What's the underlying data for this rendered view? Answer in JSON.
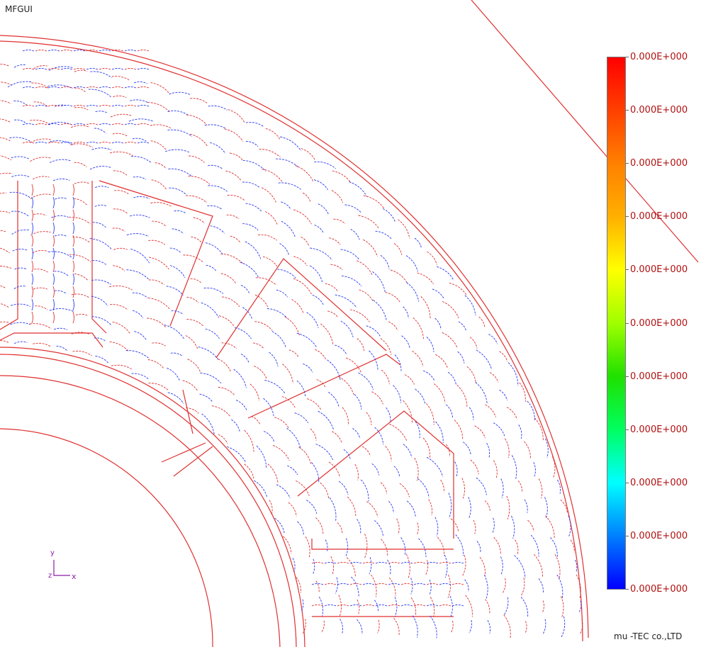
{
  "app": {
    "title": "MFGUI",
    "footer": "mu -TEC co.,LTD"
  },
  "colorbar": {
    "labels": [
      "0.000E+000",
      "0.000E+000",
      "0.000E+000",
      "0.000E+000",
      "0.000E+000",
      "0.000E+000",
      "0.000E+000",
      "0.000E+000",
      "0.000E+000",
      "0.000E+000",
      "0.000E+000"
    ],
    "gradient_colors": [
      "#ff0000",
      "#ff4000",
      "#ff8000",
      "#ffb000",
      "#ffff00",
      "#a0ff00",
      "#20e000",
      "#00ff60",
      "#00ffff",
      "#0080ff",
      "#0000ff"
    ],
    "label_color": "#b01010"
  },
  "axes": {
    "y": "y",
    "z": "z",
    "x": "x",
    "color": "#8a1fa8"
  },
  "mesh": {
    "outline_color": "#e03030",
    "vector_colors": [
      "#e03030",
      "#2a3af0"
    ]
  }
}
